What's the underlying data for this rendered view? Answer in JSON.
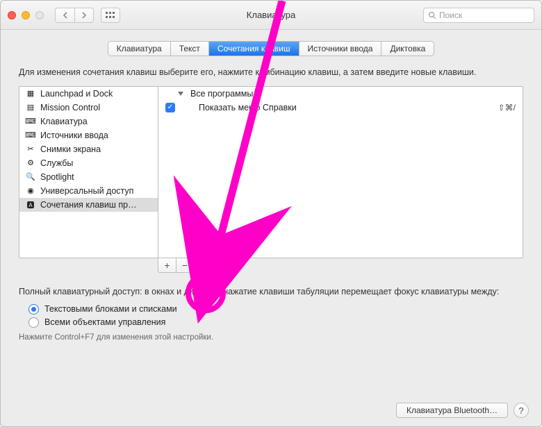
{
  "window": {
    "title": "Клавиатура"
  },
  "titlebar": {
    "search_placeholder": "Поиск"
  },
  "tabs": [
    {
      "label": "Клавиатура"
    },
    {
      "label": "Текст"
    },
    {
      "label": "Сочетания клавиш",
      "active": true
    },
    {
      "label": "Источники ввода"
    },
    {
      "label": "Диктовка"
    }
  ],
  "hint": "Для изменения сочетания клавиш выберите его, нажмите комбинацию клавиш, а затем введите новые клавиши.",
  "categories": [
    {
      "label": "Launchpad и Dock",
      "icon": "launchpad"
    },
    {
      "label": "Mission Control",
      "icon": "mission"
    },
    {
      "label": "Клавиатура",
      "icon": "keyboard"
    },
    {
      "label": "Источники ввода",
      "icon": "keyboard"
    },
    {
      "label": "Снимки экрана",
      "icon": "screenshot"
    },
    {
      "label": "Службы",
      "icon": "gear"
    },
    {
      "label": "Spotlight",
      "icon": "spotlight"
    },
    {
      "label": "Универсальный доступ",
      "icon": "accessibility"
    },
    {
      "label": "Сочетания клавиш пр…",
      "icon": "apps",
      "selected": true
    }
  ],
  "right_pane": {
    "group_label": "Все программы",
    "items": [
      {
        "checked": true,
        "label": "Показать меню Справки",
        "shortcut": "⇧⌘/"
      }
    ]
  },
  "buttons": {
    "add": "+",
    "remove": "−"
  },
  "fka": {
    "text": "Полный клавиатурный доступ: в окнах и диалогах нажатие клавиши табуляции перемещает фокус клавиатуры между:",
    "option1": "Текстовыми блоками и списками",
    "option2": "Всеми объектами управления",
    "note": "Нажмите Control+F7 для изменения этой настройки."
  },
  "footer": {
    "bluetooth": "Клавиатура Bluetooth…"
  }
}
